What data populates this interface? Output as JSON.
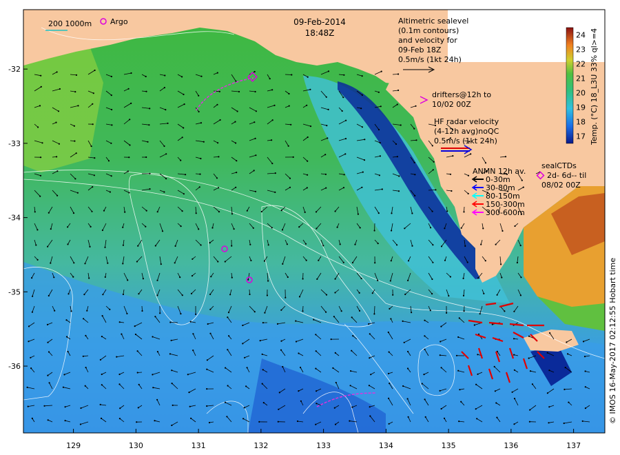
{
  "header": {
    "date": "09-Feb-2014",
    "time": "18:48Z"
  },
  "top_left_legend": {
    "isobath_label": "200  1000m",
    "argo_label": "Argo"
  },
  "altimetry_note": {
    "lines": [
      "Altimetric sealevel",
      "(0.1m contours)",
      "and velocity for",
      "09-Feb 18Z",
      "0.5m/s (1kt 24h)"
    ]
  },
  "drifters_note": {
    "lines": [
      "drifters@12h to",
      "10/02 00Z"
    ]
  },
  "hf_radar_note": {
    "lines": [
      "HF radar velocity",
      "(4-12h avg)noQC",
      "0.5m/s (1kt 24h)"
    ]
  },
  "anmn_legend": {
    "title": "ANMN 12h av.",
    "items": [
      {
        "label": "0-30m",
        "color": "#000000"
      },
      {
        "label": "30-80m",
        "color": "#0000ff"
      },
      {
        "label": "80-150m",
        "color": "#00ffff"
      },
      {
        "label": "150-300m",
        "color": "#ff0000"
      },
      {
        "label": "300-600m",
        "color": "#ff00ff"
      }
    ]
  },
  "seal_ctd_note": {
    "lines": [
      "sealCTDs",
      "2d- 6d-- til",
      "08/02 00Z"
    ]
  },
  "colorbar": {
    "label": "Temp. (°C) 18_L3U 33% ql>=4",
    "min": 16.5,
    "max": 24.5,
    "ticks": [
      "17",
      "18",
      "19",
      "20",
      "21",
      "22",
      "23",
      "24"
    ]
  },
  "axes": {
    "x_ticks": [
      "129",
      "130",
      "131",
      "132",
      "133",
      "134",
      "135",
      "136",
      "137"
    ],
    "y_ticks": [
      "-32",
      "-33",
      "-34",
      "-35",
      "-36"
    ],
    "x_range": [
      128.2,
      137.5
    ],
    "y_range": [
      -36.9,
      -31.2
    ]
  },
  "credit": "© IMOS 16-May-2017 02:12:55 Hobart time",
  "colors": {
    "land": "#f8c8a0",
    "ocean_green": "#4cc24c",
    "ocean_blue": "#3aa0e6",
    "deep_blue": "#0a2a9a",
    "argo_marker": "#dd00dd"
  }
}
